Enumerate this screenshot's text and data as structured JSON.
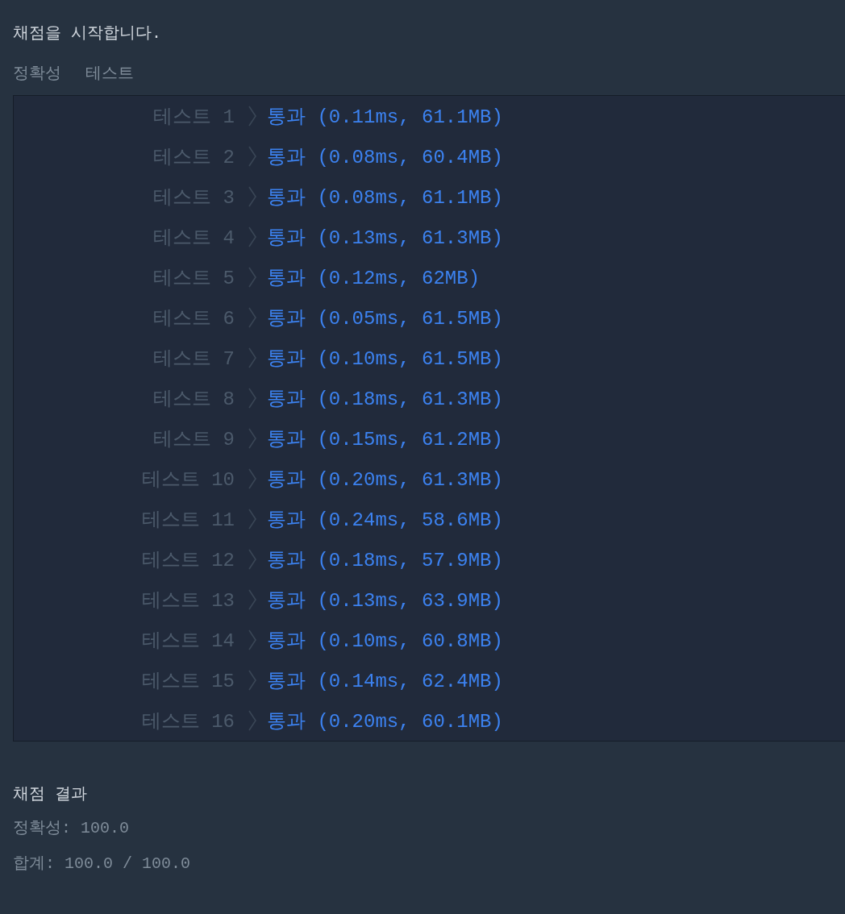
{
  "intro": "채점을 시작합니다.",
  "test_group": {
    "category": "정확성",
    "label": "테스트"
  },
  "rows": [
    {
      "label": "테스트 1",
      "passed": true,
      "result": "통과 (0.11ms, 61.1MB)"
    },
    {
      "label": "테스트 2",
      "passed": true,
      "result": "통과 (0.08ms, 60.4MB)"
    },
    {
      "label": "테스트 3",
      "passed": true,
      "result": "통과 (0.08ms, 61.1MB)"
    },
    {
      "label": "테스트 4",
      "passed": true,
      "result": "통과 (0.13ms, 61.3MB)"
    },
    {
      "label": "테스트 5",
      "passed": true,
      "result": "통과 (0.12ms, 62MB)"
    },
    {
      "label": "테스트 6",
      "passed": true,
      "result": "통과 (0.05ms, 61.5MB)"
    },
    {
      "label": "테스트 7",
      "passed": true,
      "result": "통과 (0.10ms, 61.5MB)"
    },
    {
      "label": "테스트 8",
      "passed": true,
      "result": "통과 (0.18ms, 61.3MB)"
    },
    {
      "label": "테스트 9",
      "passed": true,
      "result": "통과 (0.15ms, 61.2MB)"
    },
    {
      "label": "테스트 10",
      "passed": true,
      "result": "통과 (0.20ms, 61.3MB)"
    },
    {
      "label": "테스트 11",
      "passed": true,
      "result": "통과 (0.24ms, 58.6MB)"
    },
    {
      "label": "테스트 12",
      "passed": true,
      "result": "통과 (0.18ms, 57.9MB)"
    },
    {
      "label": "테스트 13",
      "passed": true,
      "result": "통과 (0.13ms, 63.9MB)"
    },
    {
      "label": "테스트 14",
      "passed": true,
      "result": "통과 (0.10ms, 60.8MB)"
    },
    {
      "label": "테스트 15",
      "passed": true,
      "result": "통과 (0.14ms, 62.4MB)"
    },
    {
      "label": "테스트 16",
      "passed": true,
      "result": "통과 (0.20ms, 60.1MB)"
    }
  ],
  "summary": {
    "title": "채점 결과",
    "lines": [
      "정확성: 100.0",
      "합계: 100.0 / 100.0"
    ]
  }
}
